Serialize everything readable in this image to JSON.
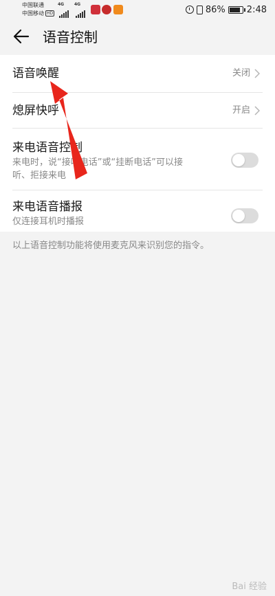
{
  "status_bar": {
    "carrier_1": "中国联通",
    "carrier_2": "中国移动",
    "hd_label": "HD",
    "signal_1_type": "4G",
    "signal_2_type": "4G",
    "battery_percent": "86%",
    "time": "2:48"
  },
  "header": {
    "back_icon": "arrow-left-icon",
    "title": "语音控制"
  },
  "settings": [
    {
      "title": "语音唤醒",
      "value": "关闭",
      "control": "chevron"
    },
    {
      "title": "熄屏快呼",
      "value": "开启",
      "control": "chevron"
    },
    {
      "title": "来电语音控制",
      "subtitle": "来电时，说“接听电话”或“挂断电话”可以接",
      "subtitle_2": "听、拒接来电",
      "control": "toggle",
      "toggle_on": false
    },
    {
      "title": "来电语音播报",
      "subtitle": "仅连接耳机时播报",
      "control": "toggle",
      "toggle_on": false
    }
  ],
  "footnote": "以上语音控制功能将使用麦克风来识别您的指令。",
  "annotation": {
    "color": "#e8261c"
  },
  "watermark": "Bai  经验"
}
